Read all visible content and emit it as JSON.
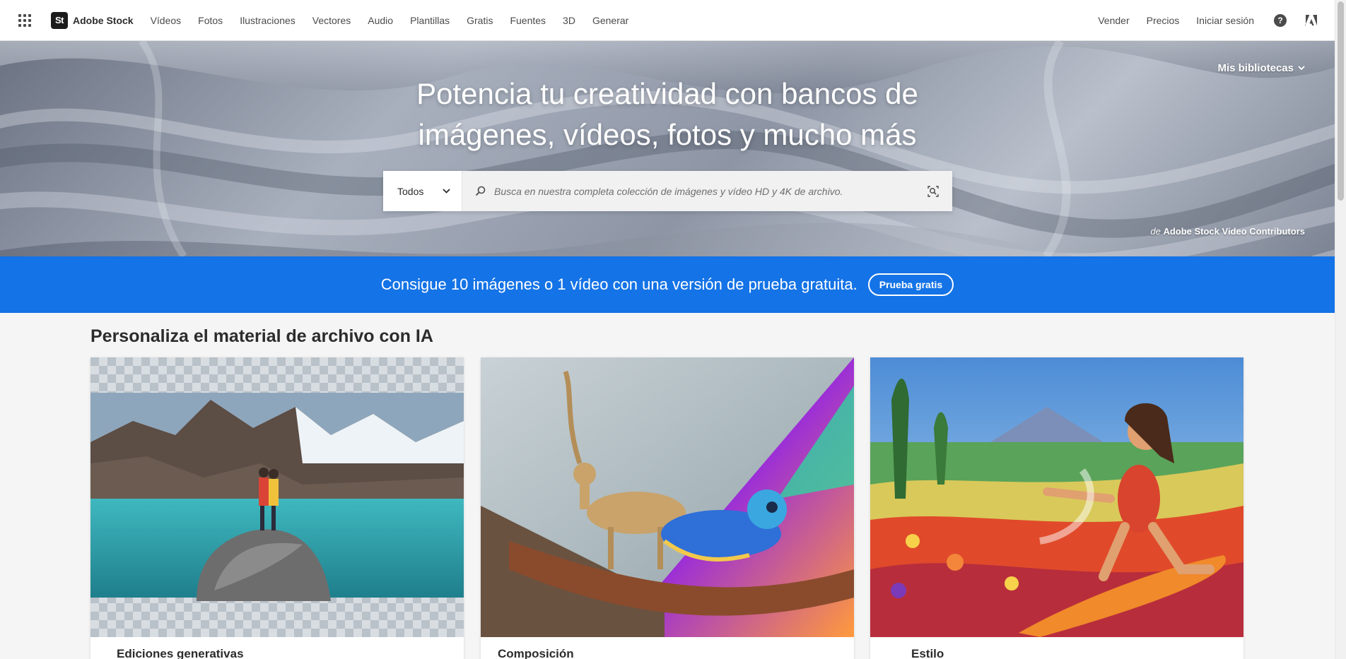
{
  "header": {
    "brand_logo": "St",
    "brand_name": "Adobe Stock",
    "nav": [
      "Vídeos",
      "Fotos",
      "Ilustraciones",
      "Vectores",
      "Audio",
      "Plantillas",
      "Gratis",
      "Fuentes",
      "3D",
      "Generar"
    ],
    "right": [
      "Vender",
      "Precios",
      "Iniciar sesión"
    ],
    "help_glyph": "?"
  },
  "hero": {
    "libraries_label": "Mis bibliotecas",
    "title_line1": "Potencia tu creatividad con bancos de",
    "title_line2": "imágenes, vídeos, fotos y mucho más",
    "search": {
      "category": "Todos",
      "placeholder": "Busca en nuestra completa colección de imágenes y vídeo HD y 4K de archivo."
    },
    "credit_prefix": "de",
    "credit_name": "Adobe Stock Video Contributors"
  },
  "promo": {
    "text": "Consigue 10 imágenes o 1 vídeo con una versión de prueba gratuita.",
    "button": "Prueba gratis",
    "color": "#1473e6"
  },
  "section": {
    "title": "Personaliza el material de archivo con IA",
    "cards": [
      {
        "label": "Ediciones generativas"
      },
      {
        "label": "Composición"
      },
      {
        "label": "Estilo"
      }
    ]
  }
}
